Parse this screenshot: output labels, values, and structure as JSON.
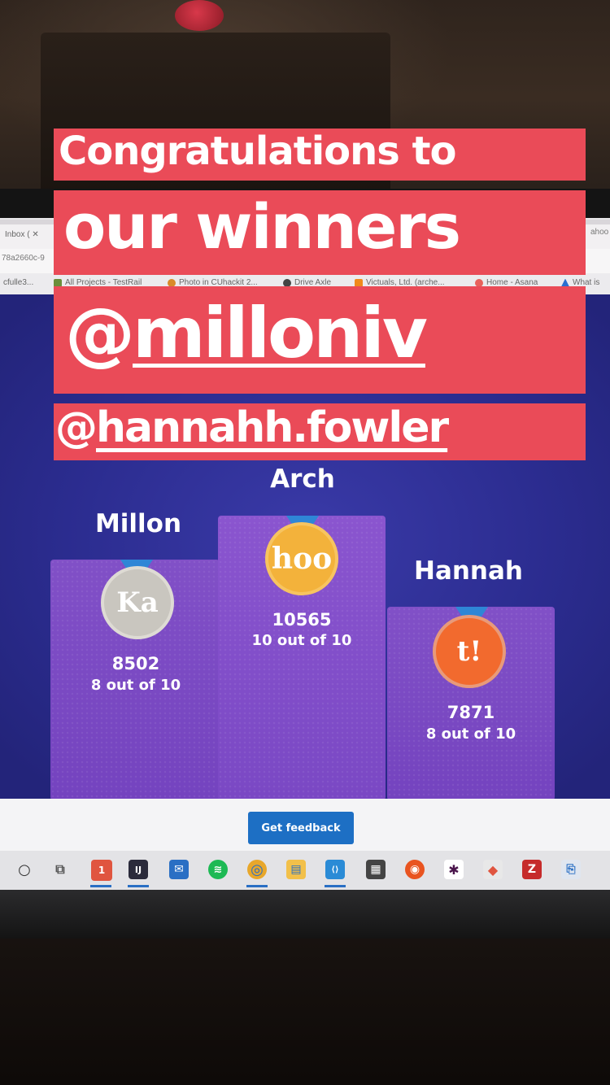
{
  "story": {
    "line1": "Congratulations to",
    "line2": "our winners",
    "mention1_at": "@",
    "mention1_name": "milloniv",
    "mention2_at": "@",
    "mention2_name": "hannahh.fowler",
    "banner_color": "#ea4b58"
  },
  "browser": {
    "tab_inbox": "Inbox ( ✕",
    "tab_right": "ahoo",
    "url_fragment": "78a2660c-9",
    "bookmarks": [
      {
        "label": "cfulle3...",
        "icon": "folder-icon"
      },
      {
        "label": "All Projects - TestRail",
        "icon": "testrail-icon"
      },
      {
        "label": "Photo in CUhackit 2...",
        "icon": "photo-icon"
      },
      {
        "label": "Drive Axle",
        "icon": "drive-icon"
      },
      {
        "label": "Victuals, Ltd. (arche...",
        "icon": "victuals-icon"
      },
      {
        "label": "Home - Asana",
        "icon": "asana-icon"
      },
      {
        "label": "What is",
        "icon": "triangle-icon"
      }
    ]
  },
  "podium": {
    "first": {
      "name": "Arch",
      "score": "10565",
      "correct": "10 out of 10",
      "medal": "hoo"
    },
    "second": {
      "name": "Millon",
      "score": "8502",
      "correct": "8 out of 10",
      "medal": "Ka"
    },
    "third": {
      "name": "Hannah",
      "score": "7871",
      "correct": "8 out of 10",
      "medal": "t!"
    }
  },
  "feedback_button": "Get feedback",
  "taskbar": {
    "items": [
      {
        "name": "cortana-icon",
        "glyph": "○"
      },
      {
        "name": "task-view-icon",
        "glyph": "⧉"
      },
      {
        "name": "notification-app-icon",
        "glyph": "1"
      },
      {
        "name": "intellij-icon",
        "glyph": "IJ"
      },
      {
        "name": "mail-icon",
        "glyph": "✉"
      },
      {
        "name": "spotify-icon",
        "glyph": "≋"
      },
      {
        "name": "chrome-icon",
        "glyph": "◎"
      },
      {
        "name": "file-explorer-icon",
        "glyph": "▤"
      },
      {
        "name": "vscode-icon",
        "glyph": "⟨⟩"
      },
      {
        "name": "store-icon",
        "glyph": "▦"
      },
      {
        "name": "ubuntu-icon",
        "glyph": "◉"
      },
      {
        "name": "slack-icon",
        "glyph": "✱"
      },
      {
        "name": "git-icon",
        "glyph": "◆"
      },
      {
        "name": "filezilla-icon",
        "glyph": "Z"
      },
      {
        "name": "network-icon",
        "glyph": "⎘"
      }
    ]
  }
}
